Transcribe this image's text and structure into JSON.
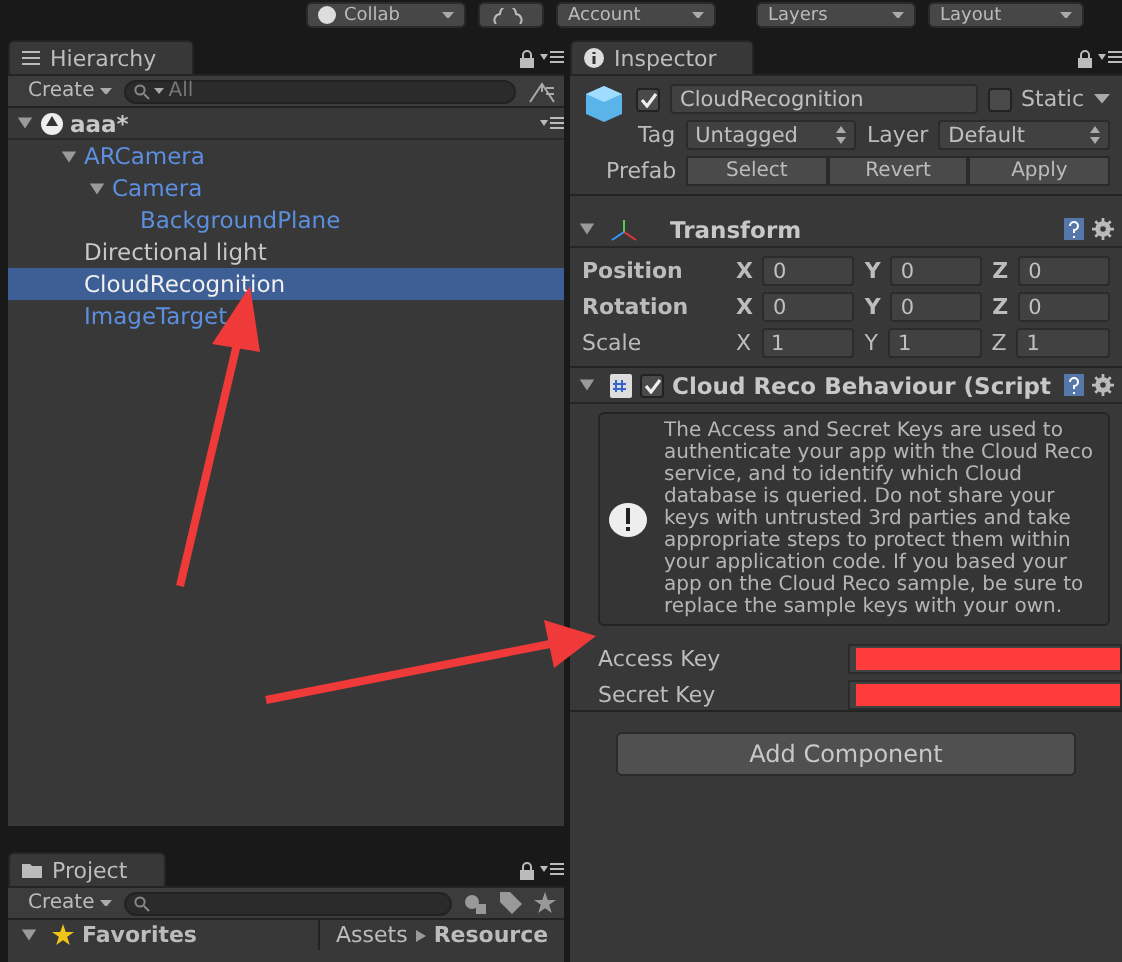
{
  "toolbar": {
    "buttons": [
      {
        "label": "Collab"
      },
      {
        "label": "Account"
      },
      {
        "label": "Layers"
      },
      {
        "label": "Layout"
      }
    ]
  },
  "hierarchy": {
    "tab": "Hierarchy",
    "create": "Create",
    "search_placeholder": "All",
    "scene": "aaa*",
    "items": [
      {
        "label": "ARCamera",
        "prefab": true,
        "selected": false,
        "expanded": true,
        "children": [
          {
            "label": "Camera",
            "prefab": true,
            "selected": false,
            "expanded": true,
            "children": [
              {
                "label": "BackgroundPlane",
                "prefab": true,
                "selected": false
              }
            ]
          }
        ]
      },
      {
        "label": "Directional light",
        "prefab": false,
        "selected": false
      },
      {
        "label": "CloudRecognition",
        "prefab": false,
        "selected": true
      },
      {
        "label": "ImageTarget",
        "prefab": true,
        "selected": false
      }
    ]
  },
  "inspector": {
    "tab": "Inspector",
    "object": {
      "active": true,
      "name": "CloudRecognition",
      "static_label": "Static",
      "static": false,
      "tag_label": "Tag",
      "tag": "Untagged",
      "layer_label": "Layer",
      "layer": "Default",
      "prefab_label": "Prefab",
      "prefab_buttons": [
        "Select",
        "Revert",
        "Apply"
      ]
    },
    "transform": {
      "title": "Transform",
      "expanded": true,
      "rows": [
        {
          "label": "Position",
          "bold": true,
          "fields": [
            {
              "axis": "X",
              "value": "0"
            },
            {
              "axis": "Y",
              "value": "0"
            },
            {
              "axis": "Z",
              "value": "0"
            }
          ]
        },
        {
          "label": "Rotation",
          "bold": true,
          "fields": [
            {
              "axis": "X",
              "value": "0"
            },
            {
              "axis": "Y",
              "value": "0"
            },
            {
              "axis": "Z",
              "value": "0"
            }
          ]
        },
        {
          "label": "Scale",
          "bold": false,
          "fields": [
            {
              "axis": "X",
              "value": "1"
            },
            {
              "axis": "Y",
              "value": "1"
            },
            {
              "axis": "Z",
              "value": "1"
            }
          ]
        }
      ]
    },
    "component": {
      "title": "Cloud Reco Behaviour (Script",
      "enabled": true,
      "expanded": true,
      "help": "The Access and Secret Keys are used to authenticate your app with the Cloud Reco service, and to identify which Cloud database is queried. Do not share your keys with untrusted 3rd parties and take appropriate steps to protect them within your application code. If you based your app on the Cloud Reco sample, be sure to replace the sample keys with your own.",
      "fields": [
        {
          "label": "Access Key"
        },
        {
          "label": "Secret Key"
        }
      ]
    },
    "add_component": "Add Component"
  },
  "project": {
    "tab": "Project",
    "create": "Create",
    "favorites": "Favorites",
    "breadcrumb": [
      "Assets",
      "Resource"
    ]
  }
}
